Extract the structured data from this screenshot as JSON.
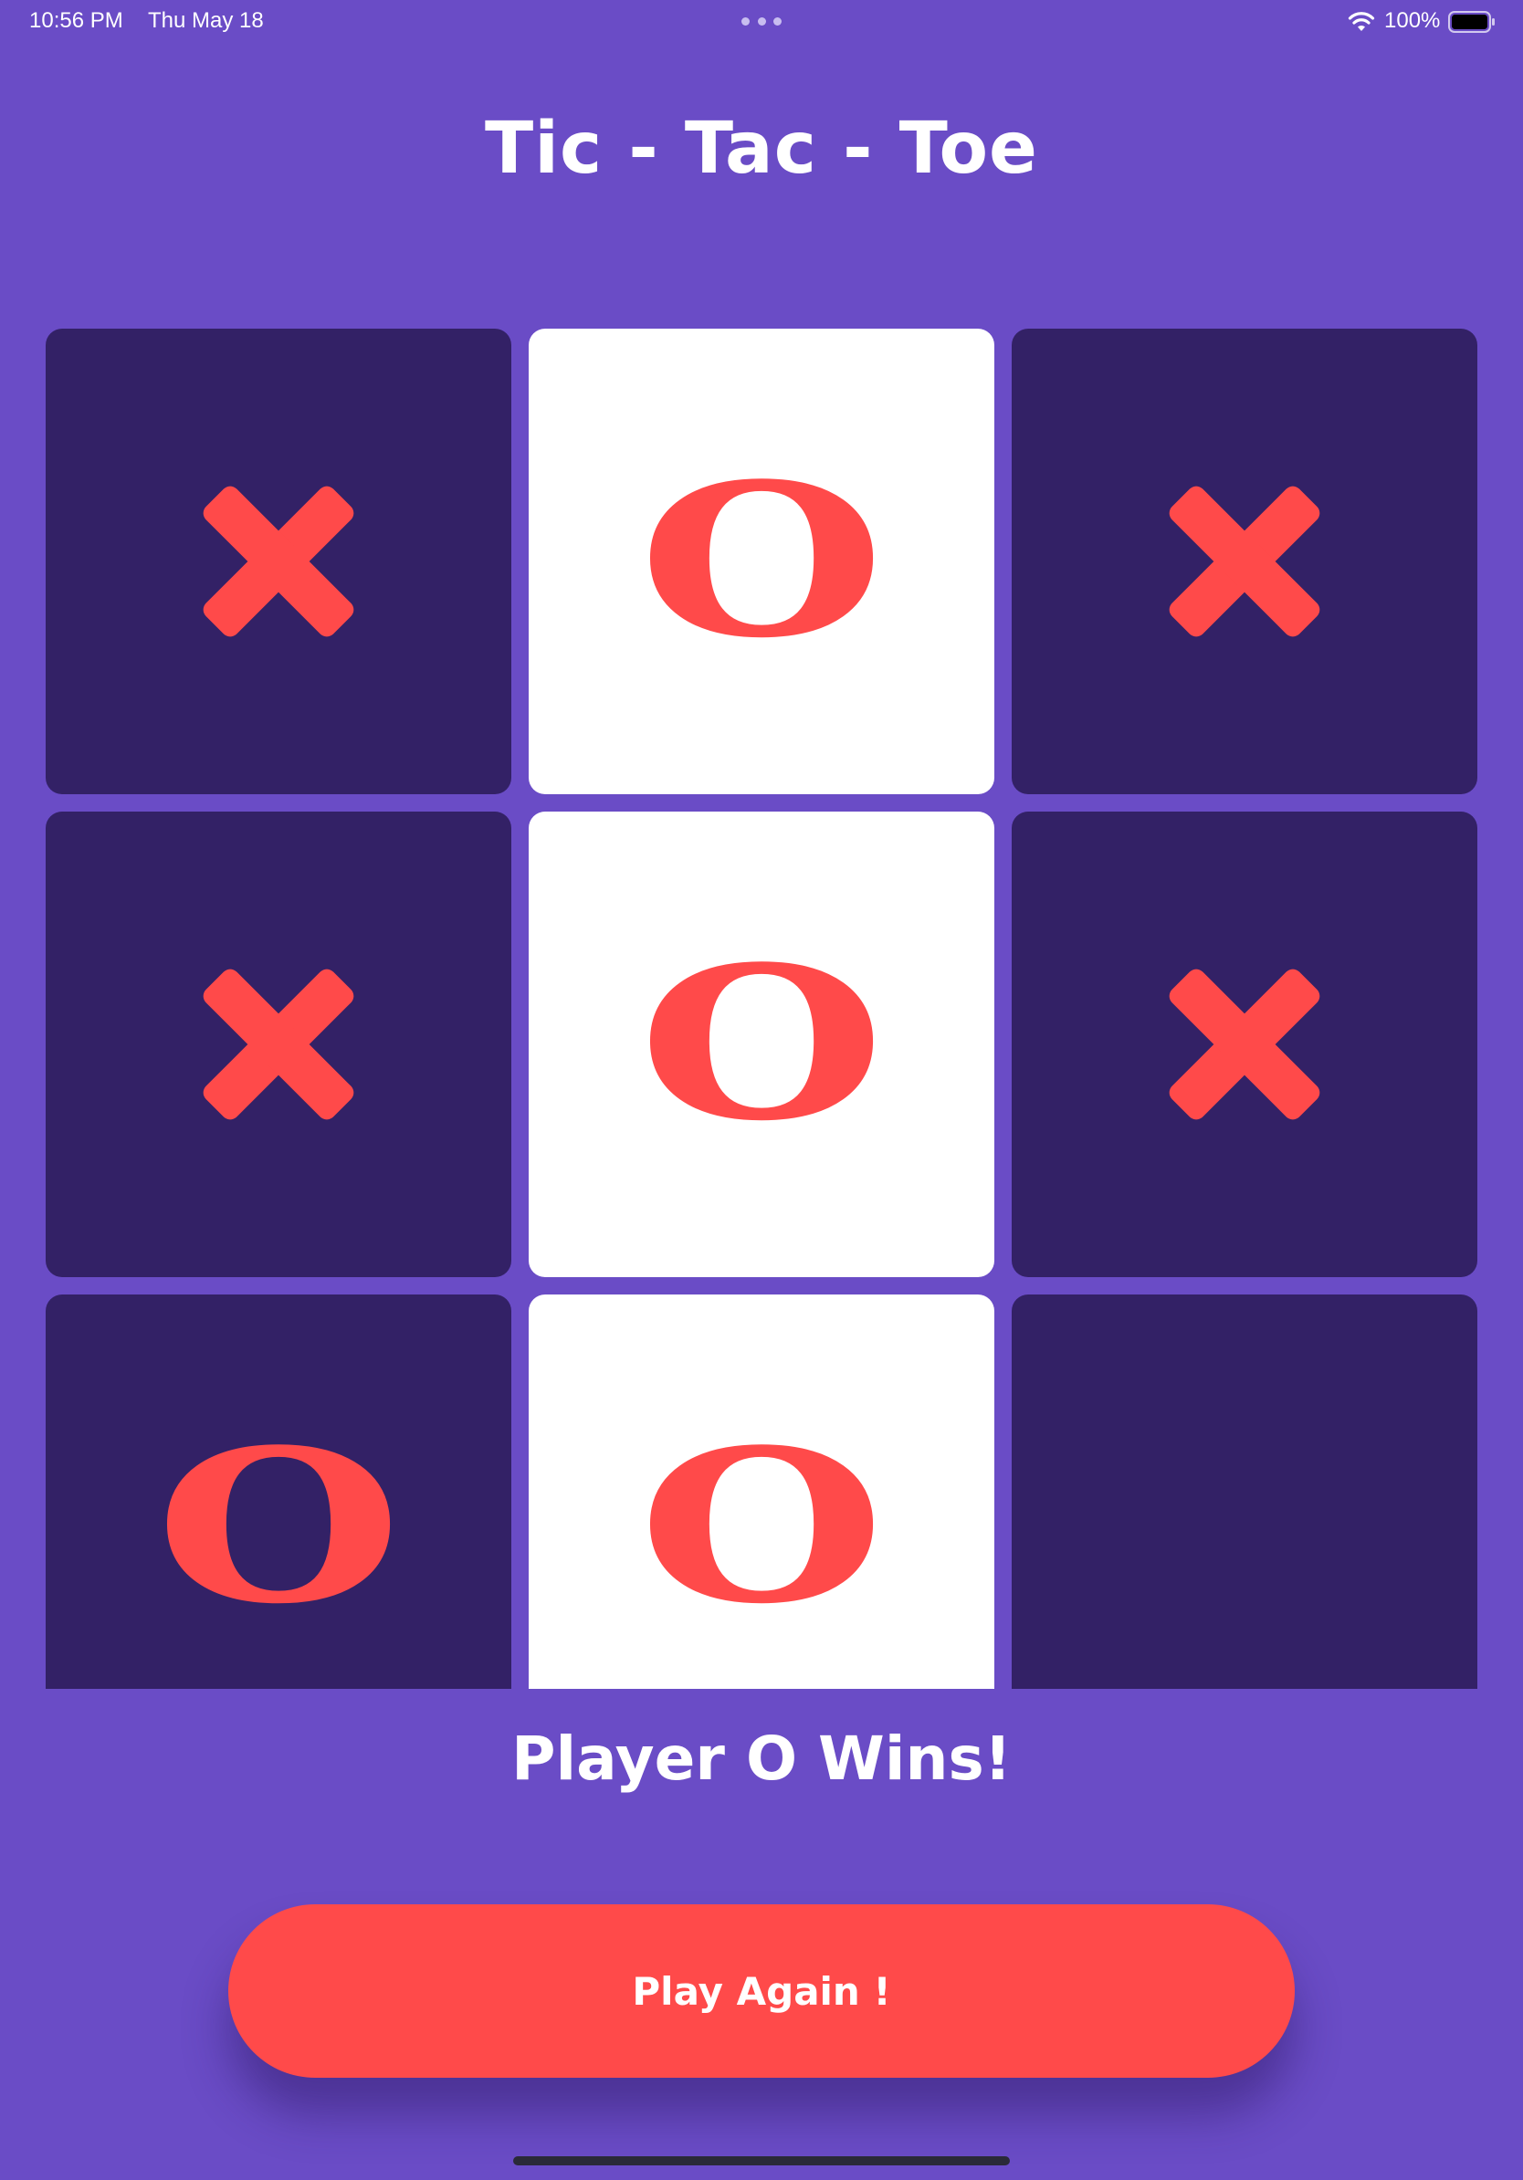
{
  "status_bar": {
    "time": "10:56 PM",
    "date": "Thu May 18",
    "battery": "100%",
    "icons": [
      "wifi-icon",
      "battery-icon"
    ]
  },
  "title": "Tic - Tac - Toe",
  "board": {
    "cells": [
      {
        "mark": "X",
        "highlighted": false
      },
      {
        "mark": "O",
        "highlighted": true
      },
      {
        "mark": "X",
        "highlighted": false
      },
      {
        "mark": "X",
        "highlighted": false
      },
      {
        "mark": "O",
        "highlighted": true
      },
      {
        "mark": "X",
        "highlighted": false
      },
      {
        "mark": "O",
        "highlighted": false
      },
      {
        "mark": "O",
        "highlighted": true
      },
      {
        "mark": "",
        "highlighted": false
      }
    ]
  },
  "result_text": "Player O Wins!",
  "play_again_label": "Play Again !",
  "colors": {
    "background": "#6a4cc6",
    "cell": "#332166",
    "highlight_cell": "#ffffff",
    "mark": "#ff4a4a",
    "button": "#ff4a4a"
  }
}
